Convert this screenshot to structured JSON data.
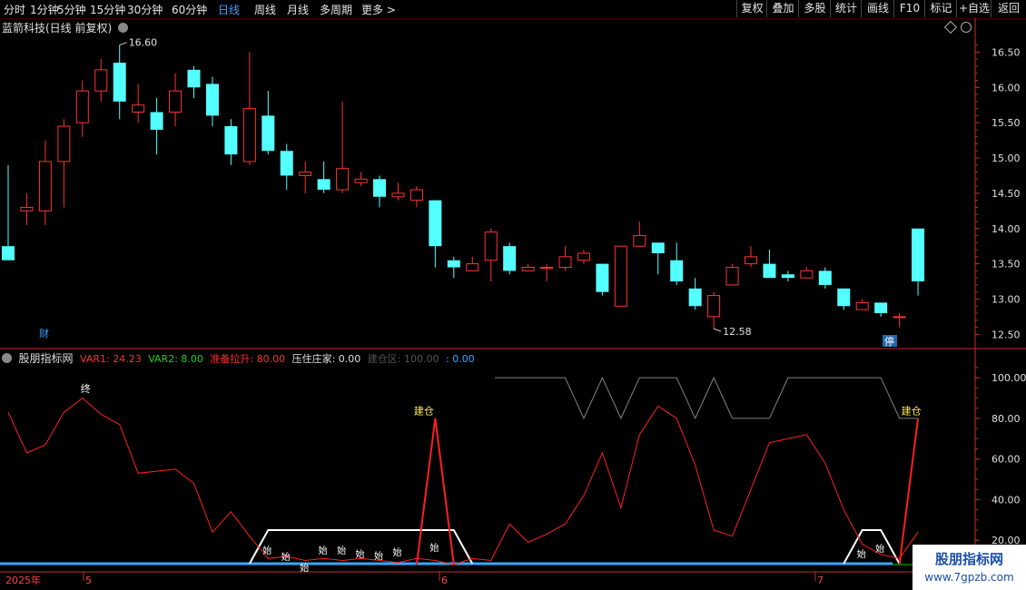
{
  "toolbar": {
    "timeframes": [
      "分时",
      "1分钟",
      "5分钟",
      "15分钟",
      "30分钟",
      "60分钟",
      "日线",
      "周线",
      "月线",
      "多周期",
      "更多 >"
    ],
    "active": "日线",
    "right_buttons": [
      "复权",
      "叠加",
      "多股",
      "统计",
      "画线",
      "F10",
      "标记",
      "+自选",
      "返回"
    ]
  },
  "main_info": {
    "title": "蓝箭科技(日线 前复权)",
    "high_label": "16.60",
    "low_label": "12.58",
    "cai_marker": "财",
    "ting_marker": "停"
  },
  "indicator": {
    "name": "股朋指标网",
    "var1_label": "VAR1: 24.23",
    "var2_label": "VAR2: 8.00",
    "zhunbei_label": "准备拉升: 80.00",
    "yazhu_label": "压住庄家: 0.00",
    "jiancang_area_label": "建仓区: 100.00",
    "extra_label": ": 0.00",
    "annotations": {
      "zhong": "终",
      "jiancang": "建仓",
      "shi": "始"
    }
  },
  "date_axis": {
    "year": "2025年",
    "months": [
      "5",
      "6",
      "7"
    ]
  },
  "watermark": {
    "line1": "股朋指标网",
    "line2": "www.7gpzb.com"
  },
  "colors": {
    "up": "#ff3232",
    "down": "#54ffff",
    "var1": "#ff2020",
    "green": "#00cc00",
    "blue": "#33aaff",
    "white": "#ffffff",
    "gray": "#808080",
    "axis": "#c03030"
  },
  "chart_data": [
    {
      "type": "candlestick",
      "title": "蓝箭科技(日线 前复权)",
      "y_ticks": [
        16.5,
        16.0,
        15.5,
        15.0,
        14.5,
        14.0,
        13.5,
        13.0,
        12.5
      ],
      "ylim": [
        12.35,
        16.75
      ],
      "candles": [
        [
          13.75,
          13.55,
          14.9,
          13.75
        ],
        [
          14.25,
          14.3,
          14.5,
          14.05
        ],
        [
          14.25,
          14.95,
          15.25,
          14.05
        ],
        [
          14.95,
          15.45,
          15.55,
          14.3
        ],
        [
          15.5,
          15.95,
          16.1,
          15.3
        ],
        [
          15.95,
          16.25,
          16.4,
          15.8
        ],
        [
          16.35,
          15.8,
          16.6,
          15.55
        ],
        [
          15.65,
          15.75,
          16.05,
          15.5
        ],
        [
          15.65,
          15.4,
          15.85,
          15.05
        ],
        [
          15.65,
          15.95,
          16.2,
          15.45
        ],
        [
          16.25,
          16.0,
          16.3,
          15.85
        ],
        [
          16.05,
          15.6,
          16.15,
          15.45
        ],
        [
          15.45,
          15.05,
          15.55,
          14.9
        ],
        [
          14.95,
          15.7,
          16.5,
          14.9
        ],
        [
          15.6,
          15.1,
          15.95,
          15.05
        ],
        [
          15.1,
          14.75,
          15.2,
          14.55
        ],
        [
          14.75,
          14.8,
          14.95,
          14.5
        ],
        [
          14.7,
          14.55,
          14.95,
          14.5
        ],
        [
          14.55,
          14.85,
          15.8,
          14.5
        ],
        [
          14.65,
          14.7,
          14.8,
          14.6
        ],
        [
          14.7,
          14.45,
          14.75,
          14.3
        ],
        [
          14.45,
          14.5,
          14.65,
          14.4
        ],
        [
          14.4,
          14.55,
          14.6,
          14.3
        ],
        [
          14.4,
          13.75,
          14.4,
          13.45
        ],
        [
          13.55,
          13.45,
          13.6,
          13.3
        ],
        [
          13.4,
          13.5,
          13.6,
          13.4
        ],
        [
          13.55,
          13.95,
          14.0,
          13.25
        ],
        [
          13.75,
          13.4,
          13.8,
          13.35
        ],
        [
          13.4,
          13.45,
          13.5,
          13.4
        ],
        [
          13.45,
          13.45,
          13.5,
          13.25
        ],
        [
          13.45,
          13.6,
          13.75,
          13.4
        ],
        [
          13.55,
          13.65,
          13.7,
          13.5
        ],
        [
          13.5,
          13.1,
          13.5,
          13.05
        ],
        [
          12.9,
          13.75,
          13.75,
          12.9
        ],
        [
          13.75,
          13.9,
          14.1,
          13.75
        ],
        [
          13.8,
          13.65,
          13.8,
          13.35
        ],
        [
          13.55,
          13.25,
          13.8,
          13.2
        ],
        [
          13.15,
          12.9,
          13.3,
          12.85
        ],
        [
          12.75,
          13.05,
          13.1,
          12.58
        ],
        [
          13.2,
          13.45,
          13.5,
          13.2
        ],
        [
          13.5,
          13.6,
          13.75,
          13.45
        ],
        [
          13.5,
          13.3,
          13.7,
          13.3
        ],
        [
          13.35,
          13.3,
          13.4,
          13.25
        ],
        [
          13.3,
          13.4,
          13.45,
          13.3
        ],
        [
          13.4,
          13.2,
          13.45,
          13.15
        ],
        [
          13.15,
          12.9,
          13.15,
          12.85
        ],
        [
          12.85,
          12.95,
          13.0,
          12.85
        ],
        [
          12.95,
          12.8,
          12.95,
          12.75
        ],
        [
          12.75,
          12.75,
          12.8,
          12.6
        ],
        [
          14.0,
          13.25,
          14.0,
          13.05
        ]
      ],
      "labels": {
        "high": "16.60",
        "low": "12.58"
      }
    },
    {
      "type": "line",
      "title": "股朋指标网",
      "y_ticks": [
        100,
        80,
        60,
        40,
        20
      ],
      "ylim": [
        8,
        109
      ],
      "series": [
        {
          "name": "VAR1",
          "values": [
            83,
            63,
            67,
            83,
            90,
            82,
            77,
            53,
            54,
            55,
            48,
            24,
            34,
            22,
            11,
            12,
            10,
            11,
            10,
            11,
            10,
            9,
            11,
            10,
            8,
            11,
            10,
            28,
            19,
            23,
            28,
            42,
            63,
            36,
            72,
            86,
            80,
            57,
            25,
            22,
            45,
            68,
            70,
            72,
            58,
            35,
            18,
            13,
            11,
            24
          ]
        },
        {
          "name": "准备拉升",
          "values": [
            null,
            null,
            null,
            null,
            null,
            null,
            null,
            null,
            null,
            null,
            null,
            null,
            null,
            null,
            null,
            null,
            null,
            null,
            null,
            null,
            null,
            null,
            8,
            80,
            8,
            null,
            null,
            null,
            null,
            null,
            null,
            null,
            null,
            null,
            null,
            null,
            null,
            null,
            null,
            null,
            null,
            null,
            null,
            null,
            null,
            null,
            null,
            null,
            8,
            80
          ]
        },
        {
          "name": "建仓区",
          "values": [
            null,
            null,
            null,
            null,
            null,
            null,
            null,
            null,
            null,
            null,
            null,
            null,
            null,
            null,
            null,
            null,
            null,
            null,
            null,
            null,
            null,
            null,
            null,
            null,
            null,
            null,
            null,
            null,
            null,
            100,
            100,
            80,
            100,
            80,
            100,
            100,
            100,
            80,
            100,
            80,
            80,
            80,
            100,
            100,
            100,
            100,
            100,
            100,
            80,
            80
          ]
        },
        {
          "name": "VAR2",
          "values": [
            8,
            8,
            8,
            8,
            8,
            8,
            8,
            8,
            8,
            8,
            8,
            8,
            8,
            8,
            8,
            8,
            8,
            8,
            8,
            8,
            8,
            8,
            8,
            8,
            8,
            8,
            8,
            8,
            8,
            8,
            8,
            8,
            8,
            8,
            8,
            8,
            8,
            8,
            8,
            8,
            8,
            8,
            8,
            8,
            8,
            8,
            8,
            8,
            8,
            8
          ]
        },
        {
          "name": "压住庄家",
          "values": [
            0,
            0,
            0,
            0,
            0,
            0,
            0,
            0,
            0,
            0,
            0,
            0,
            0,
            0,
            0,
            0,
            0,
            0,
            0,
            0,
            0,
            0,
            0,
            0,
            0,
            0,
            0,
            0,
            0,
            0,
            0,
            0,
            0,
            0,
            0,
            0,
            0,
            0,
            0,
            0,
            0,
            0,
            0,
            0,
            0,
            0,
            0,
            0,
            0,
            0
          ]
        }
      ],
      "trapezoids": [
        [
          13,
          25
        ],
        [
          45,
          48
        ]
      ]
    }
  ]
}
